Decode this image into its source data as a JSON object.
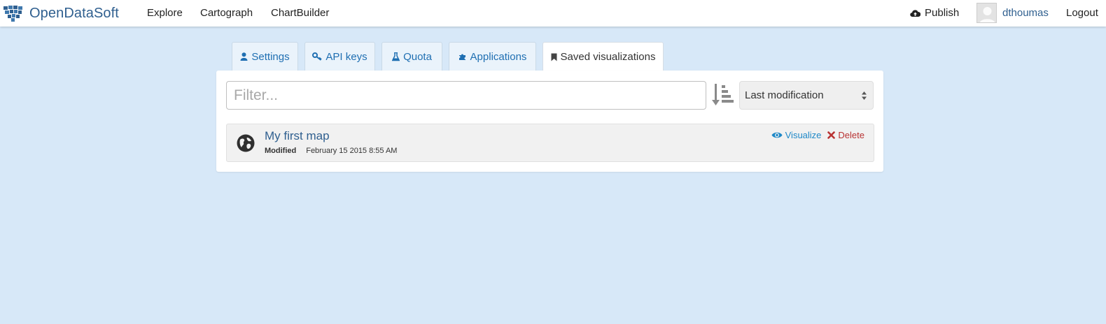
{
  "nav": {
    "brand": "OpenDataSoft",
    "links": [
      "Explore",
      "Cartograph",
      "ChartBuilder"
    ],
    "publish": "Publish",
    "username": "dthoumas",
    "logout": "Logout"
  },
  "tabs": [
    {
      "label": "Settings",
      "icon": "user-icon",
      "active": false
    },
    {
      "label": "API keys",
      "icon": "key-icon",
      "active": false
    },
    {
      "label": "Quota",
      "icon": "flask-icon",
      "active": false
    },
    {
      "label": "Applications",
      "icon": "puzzle-icon",
      "active": false
    },
    {
      "label": "Saved visualizations",
      "icon": "bookmark-icon",
      "active": true
    }
  ],
  "filter": {
    "placeholder": "Filter...",
    "value": ""
  },
  "sort": {
    "selected": "Last modification",
    "icon": "sort-amount-icon"
  },
  "visualizations": [
    {
      "title": "My first map",
      "icon": "globe-icon",
      "modified_label": "Modified",
      "modified_date": "February 15 2015 8:55 AM",
      "visualize_label": "Visualize",
      "delete_label": "Delete"
    }
  ],
  "colors": {
    "background": "#d7e8f8",
    "brand": "#2f5f8f",
    "link": "#1f6fb2",
    "visualize": "#1e88c7",
    "delete": "#b83232"
  }
}
